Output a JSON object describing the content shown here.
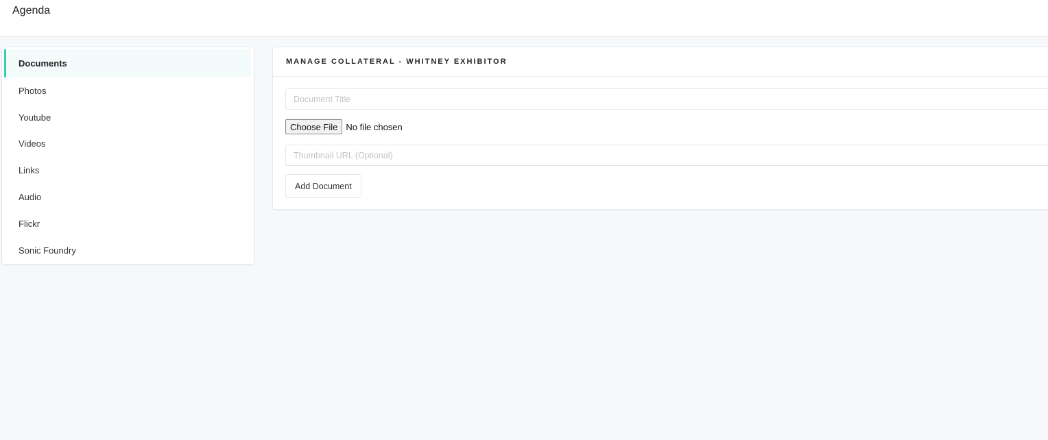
{
  "app": {
    "title": "Agenda"
  },
  "sidebar": {
    "items": [
      {
        "label": "Documents",
        "active": true
      },
      {
        "label": "Photos"
      },
      {
        "label": "Youtube"
      },
      {
        "label": "Videos"
      },
      {
        "label": "Links"
      },
      {
        "label": "Audio"
      },
      {
        "label": "Flickr"
      },
      {
        "label": "Sonic Foundry"
      }
    ]
  },
  "panel": {
    "title": "MANAGE COLLATERAL - WHITNEY EXHIBITOR",
    "document_title": {
      "value": "",
      "placeholder": "Document Title"
    },
    "file": {
      "button_label": "Choose File",
      "status": "No file chosen"
    },
    "thumbnail_url": {
      "value": "",
      "placeholder": "Thumbnail URL (Optional)"
    },
    "submit_label": "Add Document"
  },
  "colors": {
    "accent": "#33d1b5",
    "page_bg": "#f7f8fa",
    "active_item_bg": "#f4fbfb"
  }
}
